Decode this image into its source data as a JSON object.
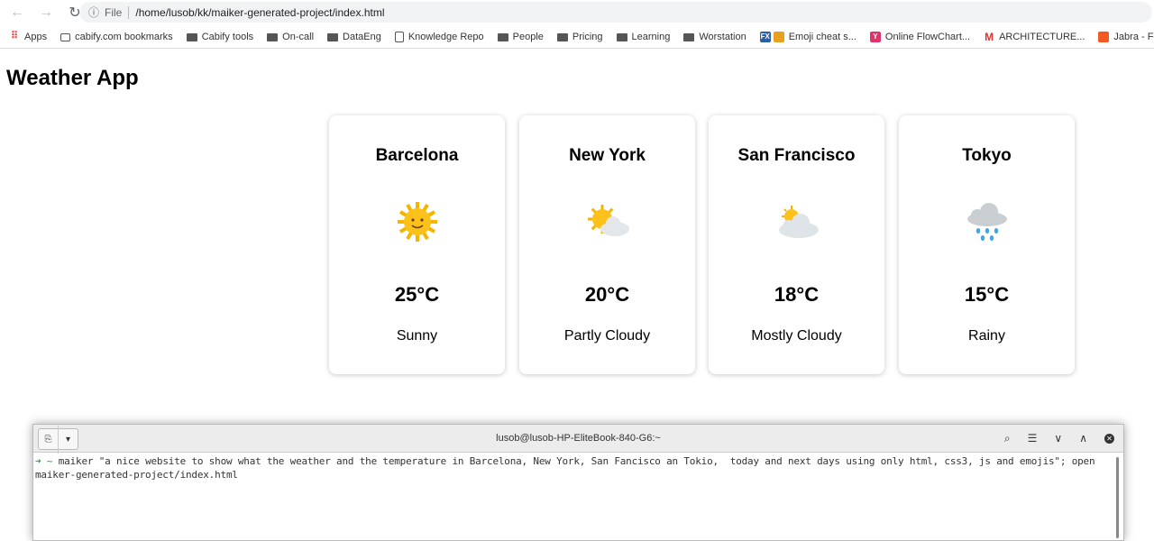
{
  "browser": {
    "url_scheme": "File",
    "url": "/home/lusob/kk/maiker-generated-project/index.html",
    "bookmarks": [
      {
        "label": "Apps",
        "icon": "apps-grid-icon"
      },
      {
        "label": "cabify.com bookmarks",
        "icon": "bookmark-icon"
      },
      {
        "label": "Cabify tools",
        "icon": "folder-icon"
      },
      {
        "label": "On-call",
        "icon": "folder-icon"
      },
      {
        "label": "DataEng",
        "icon": "folder-icon"
      },
      {
        "label": "Knowledge Repo",
        "icon": "building-icon"
      },
      {
        "label": "People",
        "icon": "folder-icon"
      },
      {
        "label": "Pricing",
        "icon": "folder-icon"
      },
      {
        "label": "Learning",
        "icon": "folder-icon"
      },
      {
        "label": "Worstation",
        "icon": "folder-icon"
      },
      {
        "label": "Emoji cheat s...",
        "icon": "gift-icon"
      },
      {
        "label": "Online FlowChart...",
        "icon": "y-icon"
      },
      {
        "label": "ARCHITECTURE...",
        "icon": "gmail-icon"
      },
      {
        "label": "Jabra - Focu",
        "icon": "jabra-icon"
      }
    ]
  },
  "page": {
    "title": "Weather App",
    "cards": [
      {
        "city": "Barcelona",
        "temp": "25°C",
        "condition": "Sunny",
        "icon": "sun"
      },
      {
        "city": "New York",
        "temp": "20°C",
        "condition": "Partly Cloudy",
        "icon": "sun-behind-cloud"
      },
      {
        "city": "San Francisco",
        "temp": "18°C",
        "condition": "Mostly Cloudy",
        "icon": "sun-behind-large-cloud"
      },
      {
        "city": "Tokyo",
        "temp": "15°C",
        "condition": "Rainy",
        "icon": "rain-cloud"
      }
    ]
  },
  "terminal": {
    "title": "lusob@lusob-HP-EliteBook-840-G6:~",
    "prompt": "~",
    "command": "maiker \"a nice website to show what the weather and the temperature in Barcelona, New York, San Fancisco an Tokio,  today and next days using only html, css3, js and emojis\"; open maiker-generated-project/index.html"
  }
}
